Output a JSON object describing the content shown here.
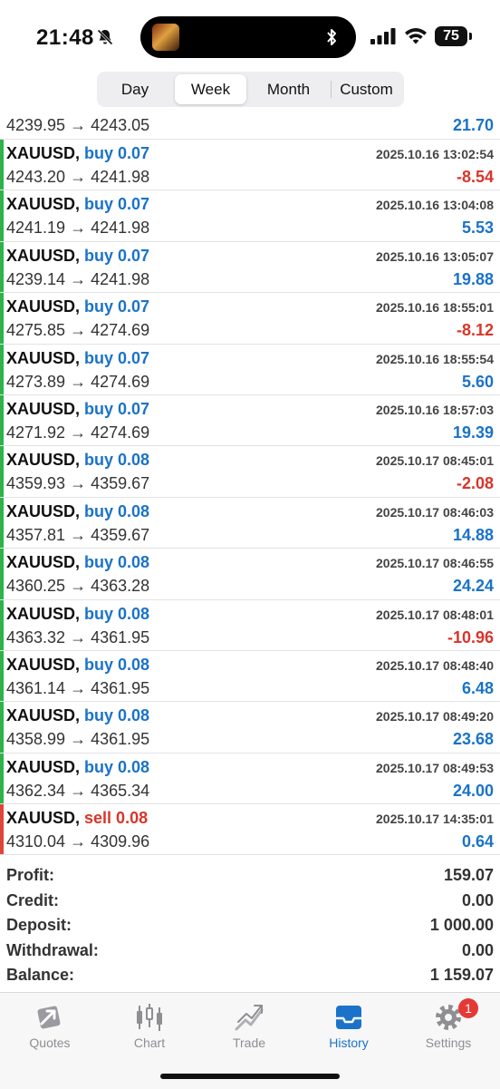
{
  "status_bar": {
    "time": "21:48",
    "battery": "75"
  },
  "segments": [
    {
      "label": "Day",
      "active": false
    },
    {
      "label": "Week",
      "active": true
    },
    {
      "label": "Month",
      "active": false
    },
    {
      "label": "Custom",
      "active": false
    }
  ],
  "top_partial": {
    "prices": "4239.95 → 4243.05",
    "profit": "21.70"
  },
  "deals": [
    {
      "symbol": "XAUUSD,",
      "action": "buy 0.07",
      "side": "buy",
      "datetime": "2025.10.16 13:02:54",
      "prices": "4243.20 → 4241.98",
      "profit": "-8.54"
    },
    {
      "symbol": "XAUUSD,",
      "action": "buy 0.07",
      "side": "buy",
      "datetime": "2025.10.16 13:04:08",
      "prices": "4241.19 → 4241.98",
      "profit": "5.53"
    },
    {
      "symbol": "XAUUSD,",
      "action": "buy 0.07",
      "side": "buy",
      "datetime": "2025.10.16 13:05:07",
      "prices": "4239.14 → 4241.98",
      "profit": "19.88"
    },
    {
      "symbol": "XAUUSD,",
      "action": "buy 0.07",
      "side": "buy",
      "datetime": "2025.10.16 18:55:01",
      "prices": "4275.85 → 4274.69",
      "profit": "-8.12"
    },
    {
      "symbol": "XAUUSD,",
      "action": "buy 0.07",
      "side": "buy",
      "datetime": "2025.10.16 18:55:54",
      "prices": "4273.89 → 4274.69",
      "profit": "5.60"
    },
    {
      "symbol": "XAUUSD,",
      "action": "buy 0.07",
      "side": "buy",
      "datetime": "2025.10.16 18:57:03",
      "prices": "4271.92 → 4274.69",
      "profit": "19.39"
    },
    {
      "symbol": "XAUUSD,",
      "action": "buy 0.08",
      "side": "buy",
      "datetime": "2025.10.17 08:45:01",
      "prices": "4359.93 → 4359.67",
      "profit": "-2.08"
    },
    {
      "symbol": "XAUUSD,",
      "action": "buy 0.08",
      "side": "buy",
      "datetime": "2025.10.17 08:46:03",
      "prices": "4357.81 → 4359.67",
      "profit": "14.88"
    },
    {
      "symbol": "XAUUSD,",
      "action": "buy 0.08",
      "side": "buy",
      "datetime": "2025.10.17 08:46:55",
      "prices": "4360.25 → 4363.28",
      "profit": "24.24"
    },
    {
      "symbol": "XAUUSD,",
      "action": "buy 0.08",
      "side": "buy",
      "datetime": "2025.10.17 08:48:01",
      "prices": "4363.32 → 4361.95",
      "profit": "-10.96"
    },
    {
      "symbol": "XAUUSD,",
      "action": "buy 0.08",
      "side": "buy",
      "datetime": "2025.10.17 08:48:40",
      "prices": "4361.14 → 4361.95",
      "profit": "6.48"
    },
    {
      "symbol": "XAUUSD,",
      "action": "buy 0.08",
      "side": "buy",
      "datetime": "2025.10.17 08:49:20",
      "prices": "4358.99 → 4361.95",
      "profit": "23.68"
    },
    {
      "symbol": "XAUUSD,",
      "action": "buy 0.08",
      "side": "buy",
      "datetime": "2025.10.17 08:49:53",
      "prices": "4362.34 → 4365.34",
      "profit": "24.00"
    },
    {
      "symbol": "XAUUSD,",
      "action": "sell 0.08",
      "side": "sell",
      "datetime": "2025.10.17 14:35:01",
      "prices": "4310.04 → 4309.96",
      "profit": "0.64"
    }
  ],
  "summary": [
    {
      "label": "Profit:",
      "value": "159.07"
    },
    {
      "label": "Credit:",
      "value": "0.00"
    },
    {
      "label": "Deposit:",
      "value": "1 000.00"
    },
    {
      "label": "Withdrawal:",
      "value": "0.00"
    },
    {
      "label": "Balance:",
      "value": "1 159.07"
    }
  ],
  "tabs": [
    {
      "label": "Quotes",
      "icon": "quotes-icon",
      "active": false
    },
    {
      "label": "Chart",
      "icon": "chart-icon",
      "active": false
    },
    {
      "label": "Trade",
      "icon": "trade-icon",
      "active": false
    },
    {
      "label": "History",
      "icon": "history-icon",
      "active": true
    },
    {
      "label": "Settings",
      "icon": "settings-icon",
      "active": false,
      "badge": "1"
    }
  ],
  "colors": {
    "buy": "#1a73c8",
    "sell": "#d9352a",
    "buy_bar": "#2db34a",
    "sell_bar": "#e0453a",
    "active_tab": "#1a73c8"
  }
}
